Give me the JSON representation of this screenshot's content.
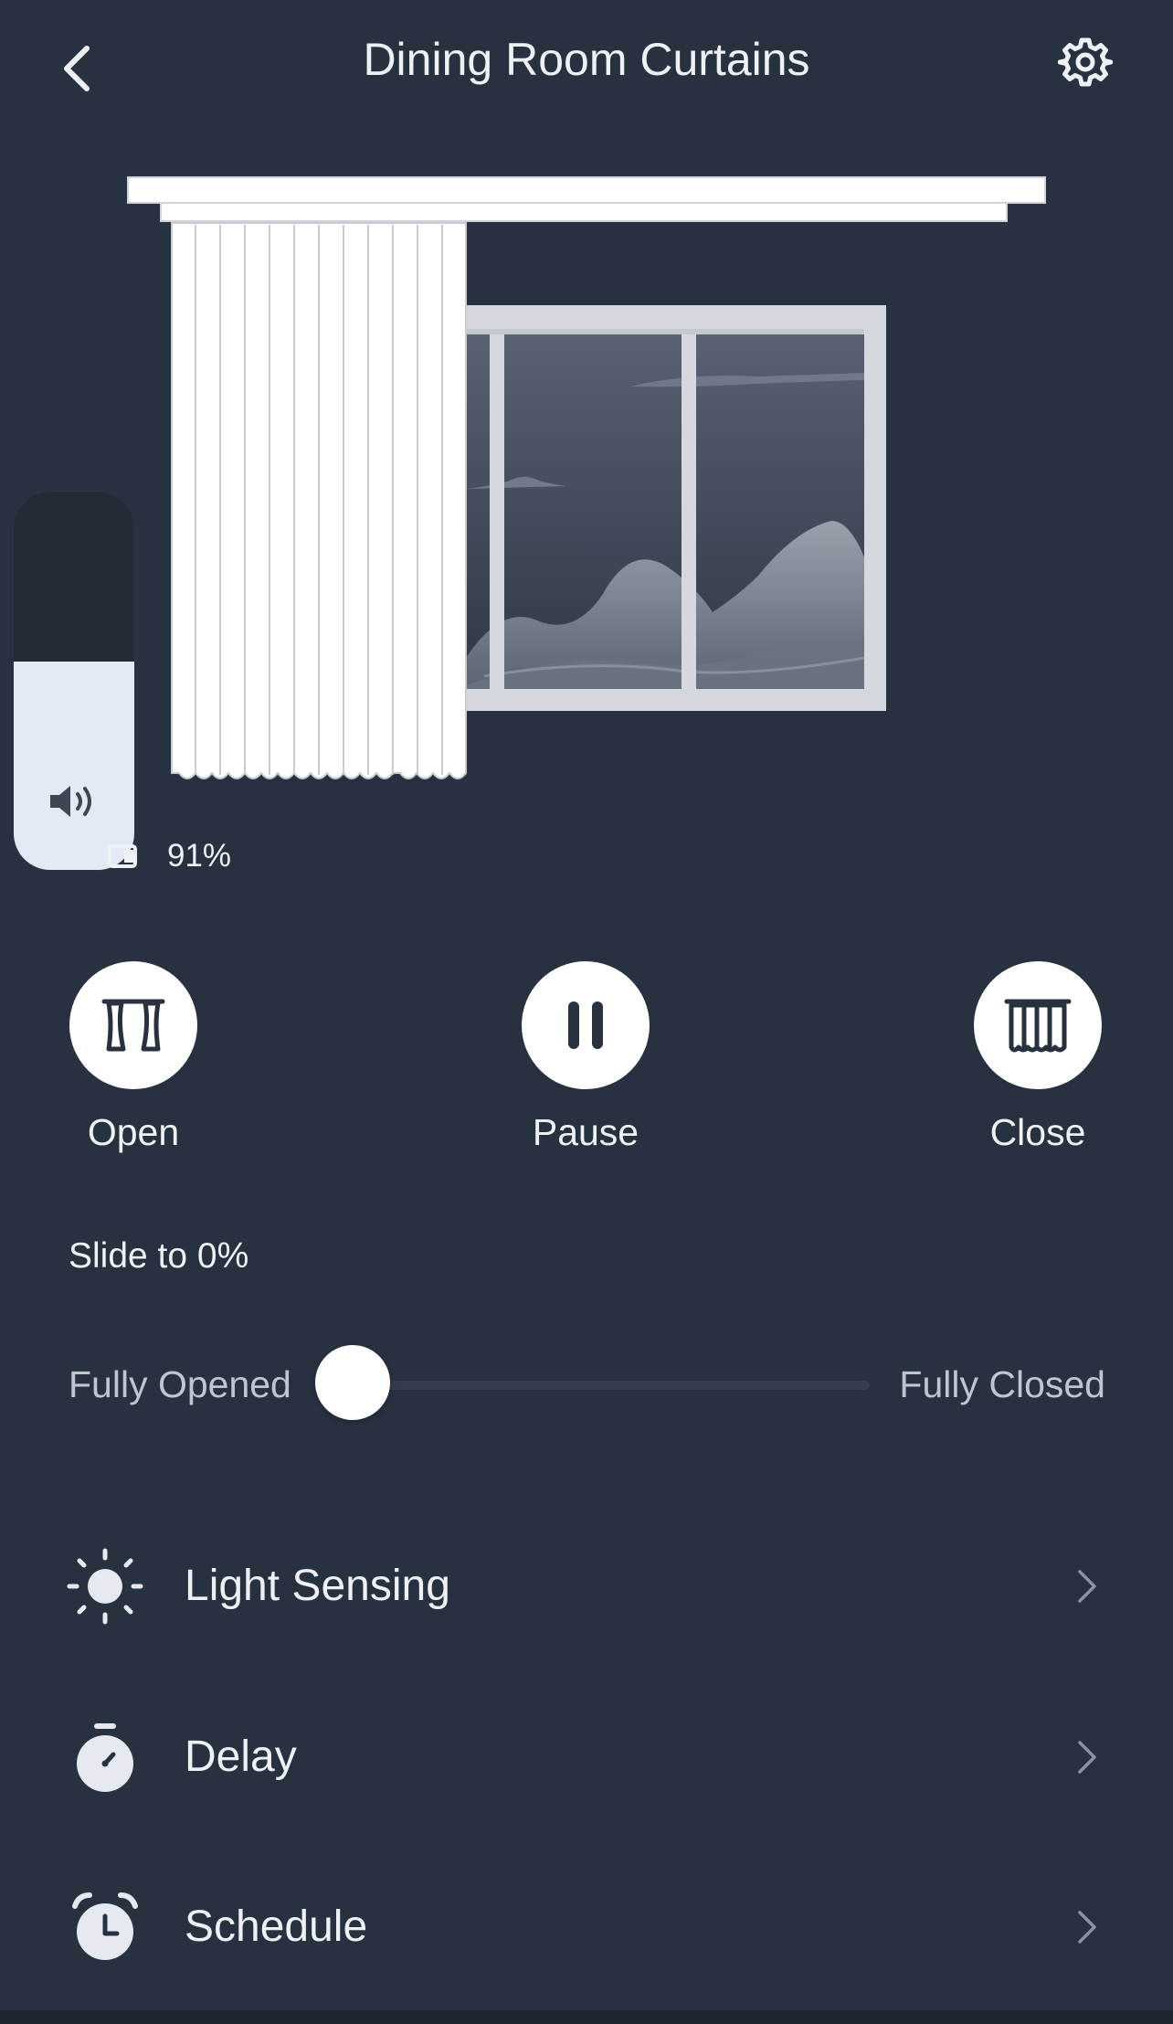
{
  "header": {
    "title": "Dining Room Curtains",
    "back_icon": "chevron-left-icon",
    "settings_icon": "gear-icon"
  },
  "status": {
    "percent": "91%"
  },
  "volume": {
    "icon": "speaker-icon",
    "level_fraction": 0.55
  },
  "controls": {
    "open_label": "Open",
    "pause_label": "Pause",
    "close_label": "Close"
  },
  "slider": {
    "title": "Slide to 0%",
    "left_label": "Fully Opened",
    "right_label": "Fully Closed",
    "value_percent": 0
  },
  "menu": [
    {
      "label": "Light Sensing",
      "icon": "sun-icon"
    },
    {
      "label": "Delay",
      "icon": "stopwatch-icon"
    },
    {
      "label": "Schedule",
      "icon": "alarm-clock-icon"
    }
  ],
  "colors": {
    "background": "#283140",
    "text": "#eef1f5",
    "muted_text": "#bfc6d1",
    "button_bg": "#ffffff",
    "icon_dark": "#283140"
  }
}
